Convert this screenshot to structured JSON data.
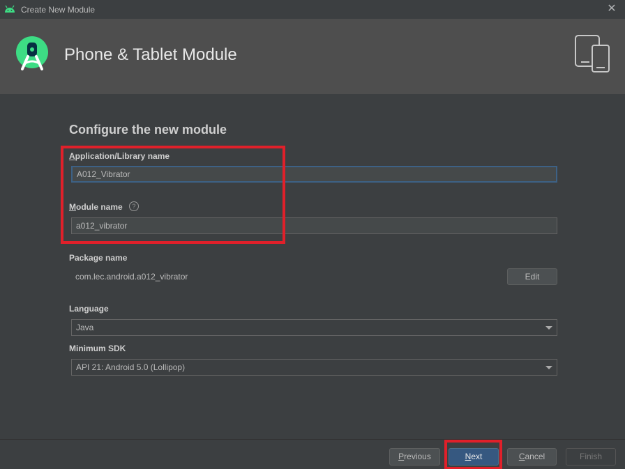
{
  "titlebar": {
    "title": "Create New Module",
    "close_glyph": "✕"
  },
  "header": {
    "heading": "Phone & Tablet Module"
  },
  "form": {
    "section_title": "Configure the new module",
    "app_name": {
      "label_mnemonic": "A",
      "label_rest": "pplication/Library name",
      "value": "A012_Vibrator"
    },
    "module_name": {
      "label_mnemonic": "M",
      "label_rest": "odule name",
      "help_glyph": "?",
      "value": "a012_vibrator"
    },
    "package_name": {
      "label": "Package name",
      "value": "com.lec.android.a012_vibrator",
      "edit_label": "Edit"
    },
    "language": {
      "label": "Language",
      "selected": "Java"
    },
    "minimum_sdk": {
      "label": "Minimum SDK",
      "selected": "API 21: Android 5.0 (Lollipop)"
    }
  },
  "footer": {
    "previous": {
      "mnemonic": "P",
      "rest": "revious"
    },
    "next": {
      "mnemonic": "N",
      "rest": "ext"
    },
    "cancel": {
      "mnemonic": "C",
      "rest": "ancel"
    },
    "finish": {
      "label": "Finish"
    }
  },
  "colors": {
    "accent": "#365880",
    "annotation": "#e0202a",
    "android_green": "#3ddc84"
  }
}
